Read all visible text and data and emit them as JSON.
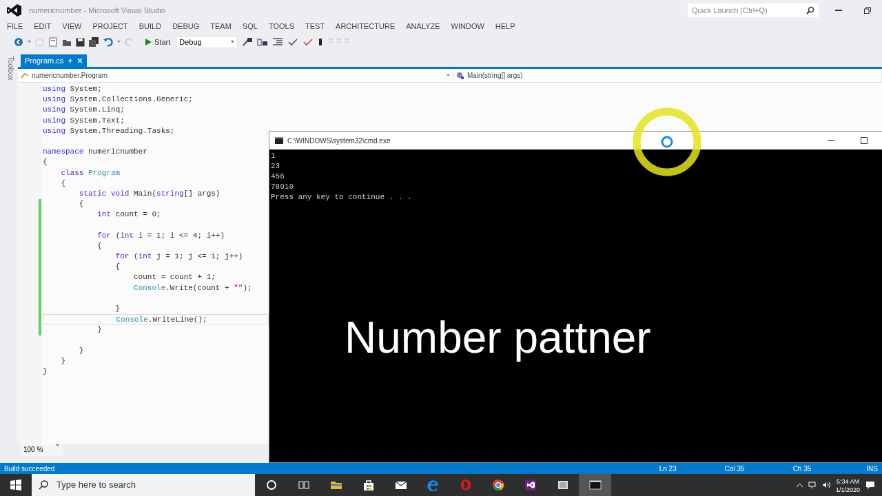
{
  "window": {
    "title": "numericnumber - Microsoft Visual Studio"
  },
  "quick_launch": {
    "placeholder": "Quick Launch (Ctrl+Q)"
  },
  "menu": [
    "FILE",
    "EDIT",
    "VIEW",
    "PROJECT",
    "BUILD",
    "DEBUG",
    "TEAM",
    "SQL",
    "TOOLS",
    "TEST",
    "ARCHITECTURE",
    "ANALYZE",
    "WINDOW",
    "HELP"
  ],
  "toolbar": {
    "start": "Start",
    "configuration": "Debug"
  },
  "toolbox": {
    "label": "Toolbox"
  },
  "tabs": [
    {
      "label": "Program.cs",
      "selected": true
    }
  ],
  "navigation": {
    "type": "numericnumber.Program",
    "member": "Main(string[] args)"
  },
  "code": [
    {
      "kind": "code",
      "current": false,
      "changed": false,
      "tokens": [
        {
          "kind": "keyword",
          "text": "using"
        },
        {
          "kind": "plain",
          "text": " System;"
        }
      ]
    },
    {
      "kind": "code",
      "current": false,
      "changed": false,
      "tokens": [
        {
          "kind": "keyword",
          "text": "using"
        },
        {
          "kind": "plain",
          "text": " System.Collections.Generic;"
        }
      ]
    },
    {
      "kind": "code",
      "current": false,
      "changed": false,
      "tokens": [
        {
          "kind": "keyword",
          "text": "using"
        },
        {
          "kind": "plain",
          "text": " System.Linq;"
        }
      ]
    },
    {
      "kind": "code",
      "current": false,
      "changed": false,
      "tokens": [
        {
          "kind": "keyword",
          "text": "using"
        },
        {
          "kind": "plain",
          "text": " System.Text;"
        }
      ]
    },
    {
      "kind": "code",
      "current": false,
      "changed": false,
      "tokens": [
        {
          "kind": "keyword",
          "text": "using"
        },
        {
          "kind": "plain",
          "text": " System.Threading.Tasks;"
        }
      ]
    },
    {
      "kind": "blank"
    },
    {
      "kind": "code",
      "current": false,
      "changed": false,
      "tokens": [
        {
          "kind": "keyword",
          "text": "namespace"
        },
        {
          "kind": "plain",
          "text": " numericnumber"
        }
      ]
    },
    {
      "kind": "code",
      "current": false,
      "changed": false,
      "tokens": [
        {
          "kind": "plain",
          "text": "{"
        }
      ]
    },
    {
      "kind": "code",
      "current": false,
      "changed": false,
      "tokens": [
        {
          "kind": "keyword",
          "text": "    class "
        },
        {
          "kind": "type",
          "text": "Program"
        }
      ]
    },
    {
      "kind": "code",
      "current": false,
      "changed": false,
      "tokens": [
        {
          "kind": "plain",
          "text": "    {"
        }
      ]
    },
    {
      "kind": "code",
      "current": false,
      "changed": false,
      "tokens": [
        {
          "kind": "keyword",
          "text": "        static void"
        },
        {
          "kind": "plain",
          "text": " Main("
        },
        {
          "kind": "keyword",
          "text": "string"
        },
        {
          "kind": "plain",
          "text": "[] args)"
        }
      ]
    },
    {
      "kind": "code",
      "current": false,
      "changed": true,
      "tokens": [
        {
          "kind": "plain",
          "text": "        {"
        }
      ]
    },
    {
      "kind": "code",
      "current": false,
      "changed": true,
      "tokens": [
        {
          "kind": "keyword",
          "text": "            int"
        },
        {
          "kind": "plain",
          "text": " count = 0;"
        }
      ]
    },
    {
      "kind": "blank",
      "changed": true
    },
    {
      "kind": "code",
      "current": false,
      "changed": true,
      "tokens": [
        {
          "kind": "keyword",
          "text": "            for"
        },
        {
          "kind": "plain",
          "text": " ("
        },
        {
          "kind": "keyword",
          "text": "int"
        },
        {
          "kind": "plain",
          "text": " i = 1; i <= 4; i++)"
        }
      ]
    },
    {
      "kind": "code",
      "current": false,
      "changed": true,
      "tokens": [
        {
          "kind": "plain",
          "text": "            {"
        }
      ]
    },
    {
      "kind": "code",
      "current": false,
      "changed": true,
      "tokens": [
        {
          "kind": "keyword",
          "text": "                for"
        },
        {
          "kind": "plain",
          "text": " ("
        },
        {
          "kind": "keyword",
          "text": "int"
        },
        {
          "kind": "plain",
          "text": " j = 1; j <= i; j++)"
        }
      ]
    },
    {
      "kind": "code",
      "current": false,
      "changed": true,
      "tokens": [
        {
          "kind": "plain",
          "text": "                {"
        }
      ]
    },
    {
      "kind": "code",
      "current": false,
      "changed": true,
      "tokens": [
        {
          "kind": "plain",
          "text": "                    count = count + 1;"
        }
      ]
    },
    {
      "kind": "code",
      "current": false,
      "changed": true,
      "tokens": [
        {
          "kind": "type",
          "text": "                    Console"
        },
        {
          "kind": "plain",
          "text": ".Write(count + "
        },
        {
          "kind": "string",
          "text": "\"\""
        },
        {
          "kind": "plain",
          "text": ");"
        }
      ]
    },
    {
      "kind": "blank",
      "changed": true
    },
    {
      "kind": "code",
      "current": false,
      "changed": true,
      "tokens": [
        {
          "kind": "plain",
          "text": "                }"
        }
      ]
    },
    {
      "kind": "code",
      "current": true,
      "changed": true,
      "tokens": [
        {
          "kind": "type",
          "text": "                Console"
        },
        {
          "kind": "plain",
          "text": ".WriteLine();"
        }
      ]
    },
    {
      "kind": "code",
      "current": false,
      "changed": true,
      "tokens": [
        {
          "kind": "plain",
          "text": "            }"
        }
      ]
    },
    {
      "kind": "blank"
    },
    {
      "kind": "code",
      "current": false,
      "changed": false,
      "tokens": [
        {
          "kind": "plain",
          "text": "        }"
        }
      ]
    },
    {
      "kind": "code",
      "current": false,
      "changed": false,
      "tokens": [
        {
          "kind": "plain",
          "text": "    }"
        }
      ]
    },
    {
      "kind": "code",
      "current": false,
      "changed": false,
      "tokens": [
        {
          "kind": "plain",
          "text": "}"
        }
      ]
    }
  ],
  "zoom": "100 %",
  "status_bar": {
    "message": "Build succeeded",
    "line": "Ln 23",
    "column": "Col 35",
    "char": "Ch 35",
    "mode": "INS"
  },
  "console": {
    "title": "C:\\WINDOWS\\system32\\cmd.exe",
    "lines": [
      "1",
      "23",
      "456",
      "78910",
      "Press any key to continue . . ."
    ]
  },
  "caption": "Number pattner",
  "taskbar": {
    "search": {
      "placeholder": "Type here to search"
    },
    "apps": [
      {
        "kind": "cortana",
        "active": false
      },
      {
        "kind": "taskview",
        "active": false
      },
      {
        "kind": "explorer",
        "active": false
      },
      {
        "kind": "store",
        "active": false
      },
      {
        "kind": "mail",
        "active": false
      },
      {
        "kind": "edge",
        "active": false
      },
      {
        "kind": "opera",
        "active": false
      },
      {
        "kind": "chrome",
        "active": false
      },
      {
        "kind": "vs",
        "active": false
      },
      {
        "kind": "app",
        "active": false
      },
      {
        "kind": "cmd",
        "active": true
      }
    ],
    "time": "5:34 AM",
    "date": "1/1/2020"
  }
}
